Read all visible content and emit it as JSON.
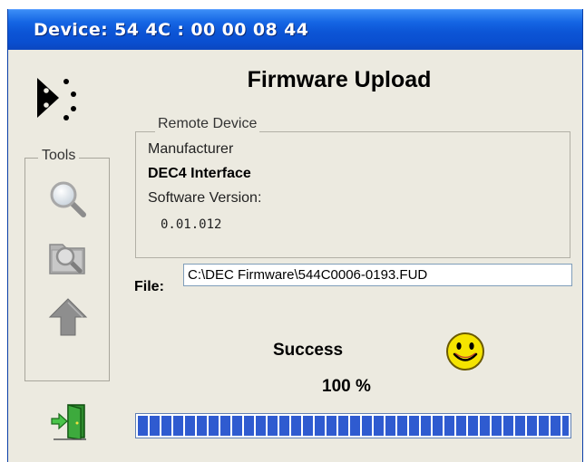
{
  "window": {
    "title": "Device:  54 4C : 00 00 08 44"
  },
  "header": {
    "title": "Firmware Upload",
    "logo_icon": "dec-logo-icon"
  },
  "tools": {
    "label": "Tools",
    "items": [
      {
        "name": "search-icon"
      },
      {
        "name": "folder-search-icon"
      },
      {
        "name": "upload-arrow-icon"
      }
    ]
  },
  "remote_device": {
    "label": "Remote Device",
    "manufacturer_label": "Manufacturer",
    "manufacturer_value": "DEC4 Interface",
    "software_version_label": "Software Version:",
    "software_version_value": "0.01.012"
  },
  "file": {
    "label": "File:",
    "value": "C:\\DEC Firmware\\544C0006-0193.FUD"
  },
  "status": {
    "text": "Success",
    "icon": "smiley-icon",
    "percent_text": "100 %",
    "progress_fraction": 1.0
  },
  "exit": {
    "icon": "exit-door-icon"
  },
  "colors": {
    "title_bar": "#0c55d6",
    "window_bg": "#eceae0",
    "progress": "#2f5bd0",
    "smiley": "#f5e400"
  }
}
